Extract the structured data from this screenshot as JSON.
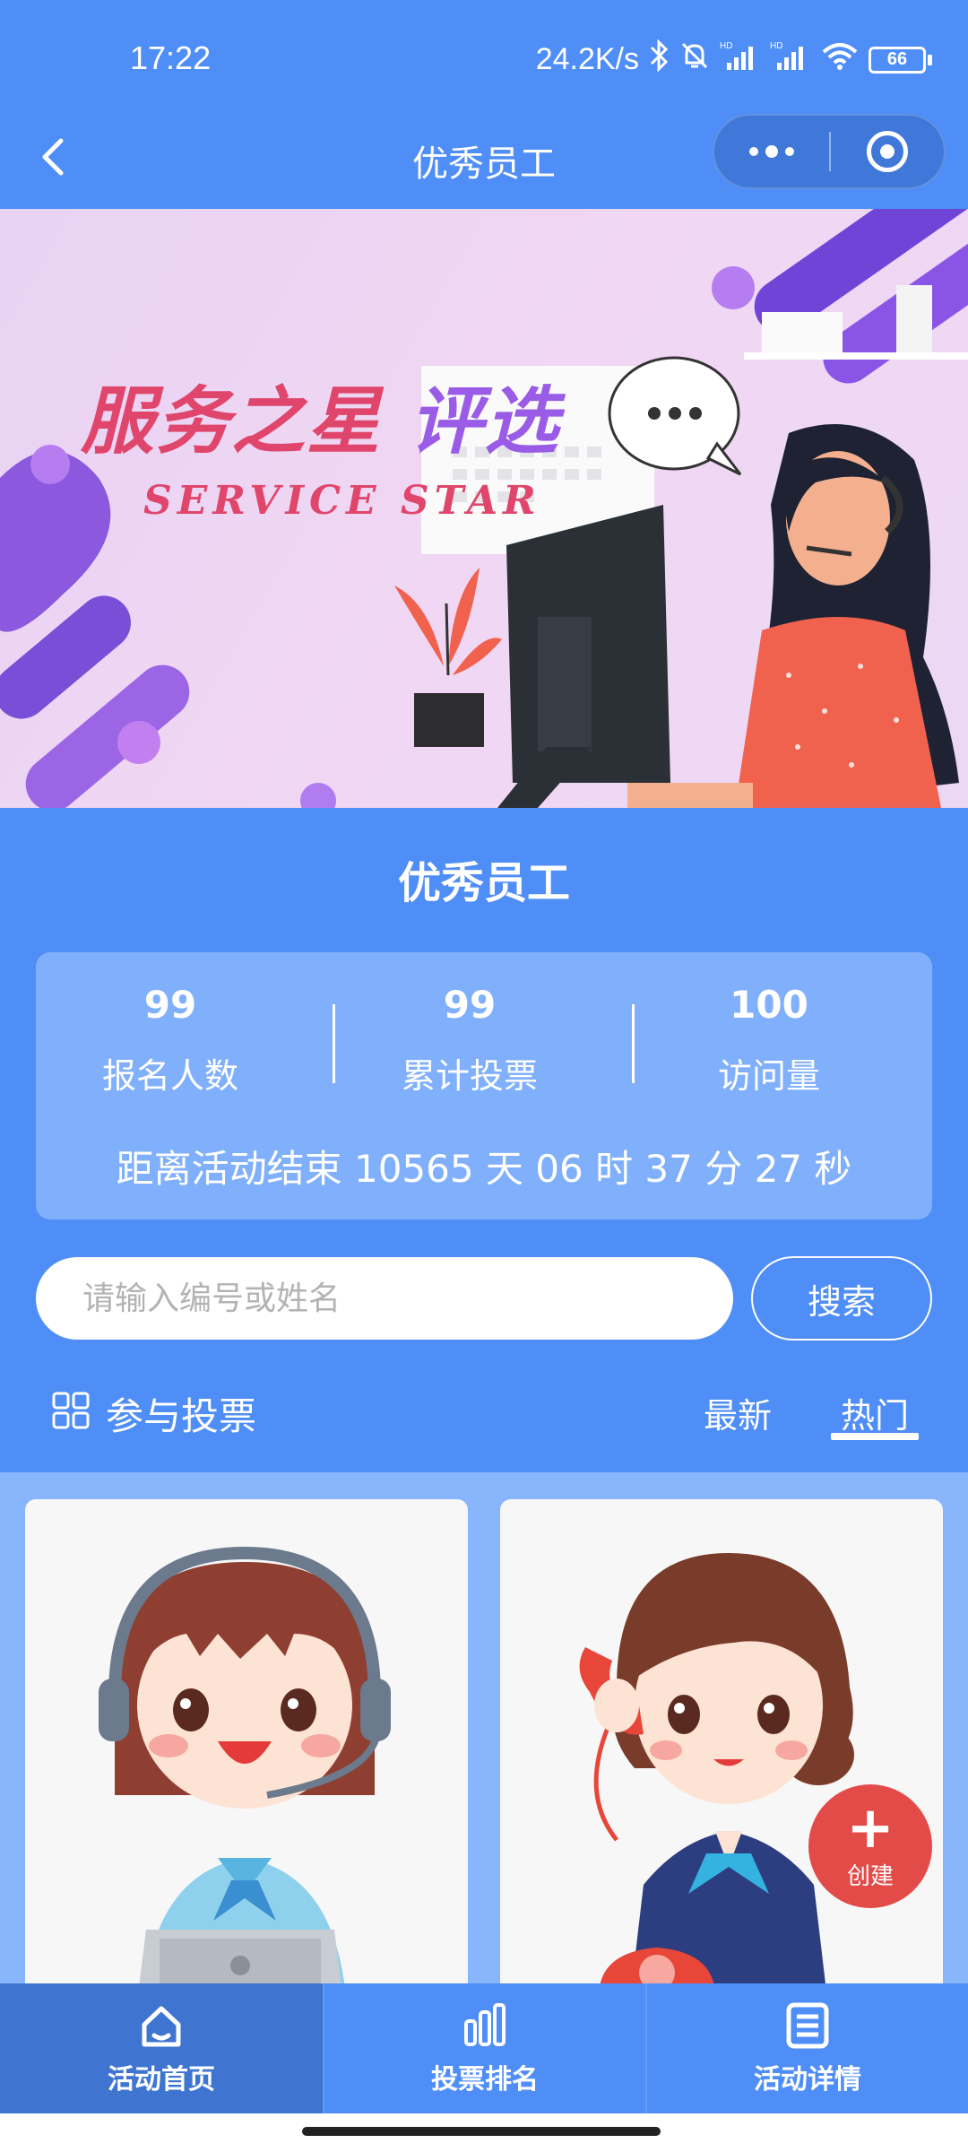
{
  "status_bar": {
    "time": "17:22",
    "speed": "24.2K/s",
    "battery": "66",
    "icons": [
      "bluetooth-icon",
      "mute-bell-icon",
      "hd-signal-icon",
      "hd-signal-icon",
      "wifi-icon",
      "battery-icon"
    ]
  },
  "nav": {
    "title": "优秀员工"
  },
  "banner": {
    "title_red": "服务之星",
    "title_purple": "评选",
    "subtitle": "SERVICE STAR"
  },
  "section": {
    "title": "优秀员工"
  },
  "stats": {
    "items": [
      {
        "value": "99",
        "label": "报名人数"
      },
      {
        "value": "99",
        "label": "累计投票"
      },
      {
        "value": "100",
        "label": "访问量"
      }
    ],
    "countdown": "距离活动结束 10565 天 06 时 37 分  27  秒"
  },
  "search": {
    "placeholder": "请输入编号或姓名",
    "button": "搜索"
  },
  "vote": {
    "label": "参与投票",
    "tabs": [
      "最新",
      "热门"
    ],
    "active_tab": "热门"
  },
  "fab": {
    "label": "创建"
  },
  "bottom_nav": {
    "items": [
      {
        "label": "活动首页",
        "icon": "home-icon"
      },
      {
        "label": "投票排名",
        "icon": "bar-chart-icon"
      },
      {
        "label": "活动详情",
        "icon": "details-icon"
      }
    ],
    "active": "活动首页"
  },
  "colors": {
    "primary": "#4f8ef7",
    "card": "#80b0fb",
    "fab": "#e34b48"
  }
}
